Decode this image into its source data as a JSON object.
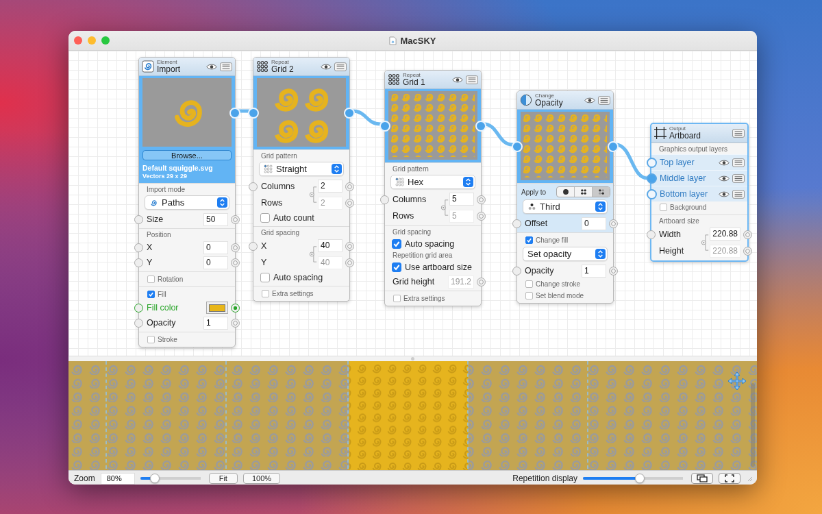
{
  "window": {
    "title": "MacSKY"
  },
  "nodes": [
    {
      "category": "Element",
      "title": "Import",
      "eye": true,
      "selected": false,
      "preview": {
        "kind": "single",
        "in_port": false,
        "out_port": true
      },
      "source": {
        "button": "Browse...",
        "file": "Default squiggle.svg",
        "info": "Vectors 29 x 29"
      },
      "sections": [
        {
          "highlighted": false,
          "rows": [
            {
              "kind": "heading",
              "text": "Import mode"
            },
            {
              "kind": "popup",
              "value": "Paths"
            },
            {
              "kind": "field",
              "label": "Size",
              "value": "50",
              "in_port": true,
              "out_port": true
            }
          ]
        },
        {
          "highlighted": false,
          "rows": [
            {
              "kind": "heading",
              "text": "Position"
            },
            {
              "kind": "field",
              "label": "X",
              "value": "0",
              "in_port": true,
              "out_port": true
            },
            {
              "kind": "field",
              "label": "Y",
              "value": "0",
              "in_port": true,
              "out_port": true
            }
          ]
        },
        {
          "highlighted": false,
          "rows": [
            {
              "kind": "section_check",
              "label": "Rotation",
              "checked": false
            }
          ]
        },
        {
          "highlighted": false,
          "rows": [
            {
              "kind": "section_check",
              "label": "Fill",
              "checked": true
            },
            {
              "kind": "color_field",
              "label": "Fill color",
              "color": "#e8b619"
            },
            {
              "kind": "field",
              "label": "Opacity",
              "value": "1",
              "in_port": true,
              "out_port": true
            }
          ]
        },
        {
          "highlighted": false,
          "rows": [
            {
              "kind": "section_check",
              "label": "Stroke",
              "checked": false
            }
          ]
        }
      ]
    },
    {
      "category": "Repeat",
      "title": "Grid 2",
      "eye": true,
      "selected": false,
      "preview": {
        "kind": "grid",
        "in_port": true,
        "out_port": true
      },
      "sections": [
        {
          "highlighted": false,
          "rows": [
            {
              "kind": "heading",
              "text": "Grid pattern"
            },
            {
              "kind": "popup",
              "value": "Straight"
            },
            {
              "kind": "linked",
              "first": {
                "label": "Columns",
                "value": "2"
              },
              "second": {
                "label": "Rows",
                "value": "2"
              }
            },
            {
              "kind": "check",
              "label": "Auto count",
              "checked": false
            }
          ]
        },
        {
          "highlighted": false,
          "rows": [
            {
              "kind": "heading",
              "text": "Grid spacing"
            },
            {
              "kind": "linked",
              "first": {
                "label": "X",
                "value": "40"
              },
              "second": {
                "label": "Y",
                "value": "40"
              }
            },
            {
              "kind": "check",
              "label": "Auto spacing",
              "checked": false
            }
          ]
        },
        {
          "highlighted": false,
          "rows": [
            {
              "kind": "section_check",
              "label": "Extra settings",
              "checked": false
            }
          ]
        }
      ]
    },
    {
      "category": "Repeat",
      "title": "Grid 1",
      "eye": true,
      "selected": false,
      "preview": {
        "kind": "dense",
        "in_port": true,
        "out_port": true
      },
      "sections": [
        {
          "highlighted": false,
          "rows": [
            {
              "kind": "heading",
              "text": "Grid pattern"
            },
            {
              "kind": "popup",
              "value": "Hex"
            },
            {
              "kind": "linked",
              "first": {
                "label": "Columns",
                "value": "5"
              },
              "second": {
                "label": "Rows",
                "value": "5"
              }
            }
          ]
        },
        {
          "highlighted": false,
          "rows": [
            {
              "kind": "heading",
              "text": "Grid spacing"
            },
            {
              "kind": "check",
              "label": "Auto spacing",
              "checked": true
            },
            {
              "kind": "heading",
              "text": "Repetition grid area"
            },
            {
              "kind": "check",
              "label": "Use artboard size",
              "checked": true
            },
            {
              "kind": "field",
              "label": "Grid height",
              "value": "191.2",
              "in_port": false,
              "out_port": true,
              "disabled": true
            }
          ]
        },
        {
          "highlighted": false,
          "rows": [
            {
              "kind": "section_check",
              "label": "Extra settings",
              "checked": false
            }
          ]
        }
      ]
    },
    {
      "category": "Change",
      "title": "Opacity",
      "eye": true,
      "selected": false,
      "preview": {
        "kind": "dense",
        "in_port": true,
        "out_port": true
      },
      "sections": [
        {
          "highlighted": true,
          "rows": [
            {
              "kind": "segmented",
              "label": "Apply to",
              "segments": [
                {
                  "selected": false
                },
                {
                  "selected": false
                },
                {
                  "selected": true
                }
              ]
            },
            {
              "kind": "popup",
              "value": "Third"
            },
            {
              "kind": "field",
              "label": "Offset",
              "value": "0",
              "in_port": true,
              "out_port": true
            }
          ]
        },
        {
          "highlighted": false,
          "rows": [
            {
              "kind": "section_check",
              "label": "Change fill",
              "checked": true
            },
            {
              "kind": "popup",
              "value": "Set opacity"
            },
            {
              "kind": "field",
              "label": "Opacity",
              "value": "1",
              "in_port": true,
              "out_port": true
            },
            {
              "kind": "section_check",
              "label": "Change stroke",
              "checked": false
            },
            {
              "kind": "section_check",
              "label": "Set blend mode",
              "checked": false
            }
          ]
        }
      ]
    },
    {
      "category": "Output",
      "title": "Artboard",
      "eye": false,
      "selected": true,
      "sections": [
        {
          "highlighted": false,
          "rows": [
            {
              "kind": "heading",
              "text": "Graphics output layers"
            },
            {
              "kind": "layer",
              "label": "Top layer",
              "connected": false
            },
            {
              "kind": "layer",
              "label": "Middle layer",
              "connected": true
            },
            {
              "kind": "layer",
              "label": "Bottom layer",
              "connected": false
            },
            {
              "kind": "section_check",
              "label": "Background",
              "checked": false
            }
          ]
        },
        {
          "highlighted": false,
          "rows": [
            {
              "kind": "heading",
              "text": "Artboard size"
            },
            {
              "kind": "linked",
              "first": {
                "label": "Width",
                "value": "220.88"
              },
              "second": {
                "label": "Height",
                "value": "220.88"
              }
            }
          ]
        }
      ]
    }
  ],
  "bottom_bar": {
    "zoom_label": "Zoom",
    "zoom_value": "80%",
    "zoom_slider": {
      "level": 0.23
    },
    "buttons": [
      "Fit",
      "100%"
    ],
    "repetition_label": "Repetition display",
    "repetition_slider": {
      "level": 0.56
    }
  }
}
